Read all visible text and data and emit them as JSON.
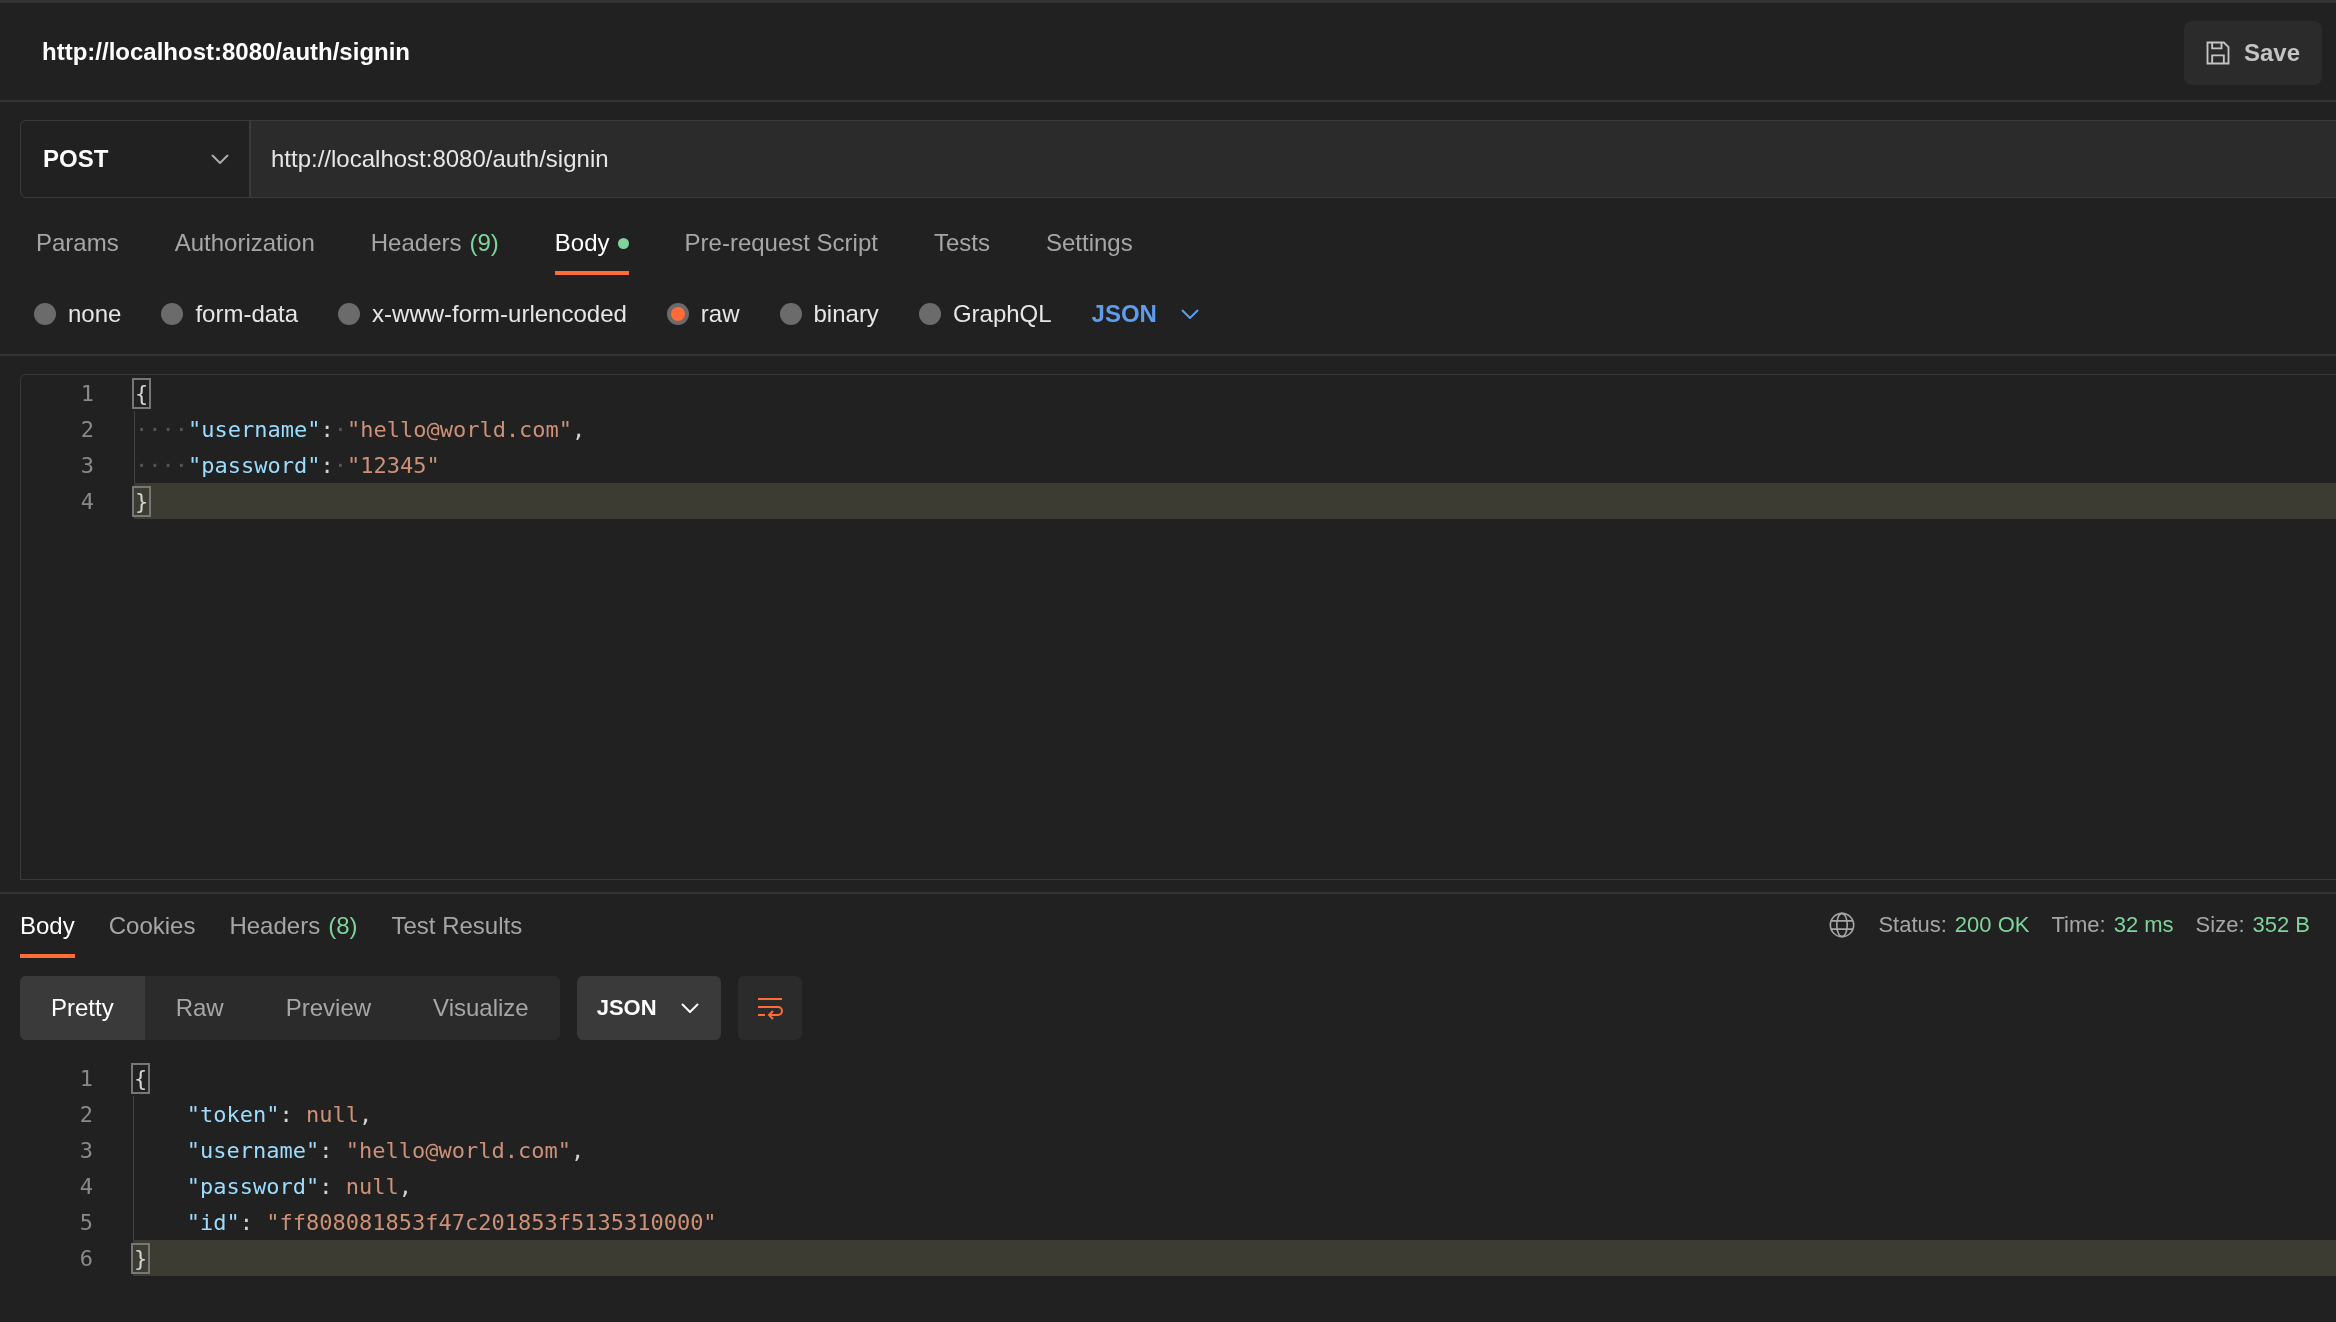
{
  "request": {
    "title": "http://localhost:8080/auth/signin",
    "save_label": "Save",
    "method": "POST",
    "url": "http://localhost:8080/auth/signin"
  },
  "request_tabs": [
    {
      "label": "Params",
      "selected": false
    },
    {
      "label": "Authorization",
      "selected": false
    },
    {
      "label": "Headers",
      "count": "(9)",
      "selected": false
    },
    {
      "label": "Body",
      "selected": true,
      "dot": true
    },
    {
      "label": "Pre-request Script",
      "selected": false
    },
    {
      "label": "Tests",
      "selected": false
    },
    {
      "label": "Settings",
      "selected": false
    }
  ],
  "body_types": [
    {
      "label": "none",
      "selected": false
    },
    {
      "label": "form-data",
      "selected": false
    },
    {
      "label": "x-www-form-urlencoded",
      "selected": false
    },
    {
      "label": "raw",
      "selected": true
    },
    {
      "label": "binary",
      "selected": false
    },
    {
      "label": "GraphQL",
      "selected": false
    }
  ],
  "body_format": "JSON",
  "request_editor": {
    "lines": [
      {
        "number": "1",
        "indented": false,
        "current": false,
        "tokens": [
          {
            "kind": "brace",
            "text": "{"
          }
        ]
      },
      {
        "number": "2",
        "indented": true,
        "current": false,
        "tokens": [
          {
            "kind": "ws",
            "text": "····"
          },
          {
            "kind": "key",
            "text": "\"username\""
          },
          {
            "kind": "punct",
            "text": ":"
          },
          {
            "kind": "ws",
            "text": "·"
          },
          {
            "kind": "string",
            "text": "\"hello@world.com\""
          },
          {
            "kind": "punct",
            "text": ","
          }
        ]
      },
      {
        "number": "3",
        "indented": true,
        "current": false,
        "tokens": [
          {
            "kind": "ws",
            "text": "····"
          },
          {
            "kind": "key",
            "text": "\"password\""
          },
          {
            "kind": "punct",
            "text": ":"
          },
          {
            "kind": "ws",
            "text": "·"
          },
          {
            "kind": "string",
            "text": "\"12345\""
          }
        ]
      },
      {
        "number": "4",
        "indented": false,
        "current": true,
        "tokens": [
          {
            "kind": "brace",
            "text": "}"
          }
        ]
      }
    ]
  },
  "response_tabs": [
    {
      "label": "Body",
      "selected": true
    },
    {
      "label": "Cookies",
      "selected": false
    },
    {
      "label": "Headers",
      "count": "(8)",
      "selected": false
    },
    {
      "label": "Test Results",
      "selected": false
    }
  ],
  "response_stats": [
    {
      "label": "Status:",
      "value": "200 OK"
    },
    {
      "label": "Time:",
      "value": "32 ms"
    },
    {
      "label": "Size:",
      "value": "352 B"
    }
  ],
  "view_modes": [
    {
      "label": "Pretty",
      "selected": true
    },
    {
      "label": "Raw",
      "selected": false
    },
    {
      "label": "Preview",
      "selected": false
    },
    {
      "label": "Visualize",
      "selected": false
    }
  ],
  "response_format": "JSON",
  "response_body": {
    "lines": [
      {
        "number": "1",
        "indented": false,
        "current": false,
        "tokens": [
          {
            "kind": "brace",
            "text": "{"
          }
        ]
      },
      {
        "number": "2",
        "indented": true,
        "current": false,
        "tokens": [
          {
            "kind": "key",
            "text": "\"token\""
          },
          {
            "kind": "punct",
            "text": ": "
          },
          {
            "kind": "null",
            "text": "null"
          },
          {
            "kind": "punct",
            "text": ","
          }
        ]
      },
      {
        "number": "3",
        "indented": true,
        "current": false,
        "tokens": [
          {
            "kind": "key",
            "text": "\"username\""
          },
          {
            "kind": "punct",
            "text": ": "
          },
          {
            "kind": "string",
            "text": "\"hello@world.com\""
          },
          {
            "kind": "punct",
            "text": ","
          }
        ]
      },
      {
        "number": "4",
        "indented": true,
        "current": false,
        "tokens": [
          {
            "kind": "key",
            "text": "\"password\""
          },
          {
            "kind": "punct",
            "text": ": "
          },
          {
            "kind": "null",
            "text": "null"
          },
          {
            "kind": "punct",
            "text": ","
          }
        ]
      },
      {
        "number": "5",
        "indented": true,
        "current": false,
        "tokens": [
          {
            "kind": "key",
            "text": "\"id\""
          },
          {
            "kind": "punct",
            "text": ": "
          },
          {
            "kind": "string",
            "text": "\"ff808081853f47c201853f5135310000\""
          }
        ]
      },
      {
        "number": "6",
        "indented": false,
        "current": true,
        "tokens": [
          {
            "kind": "brace",
            "text": "}"
          }
        ]
      }
    ]
  }
}
